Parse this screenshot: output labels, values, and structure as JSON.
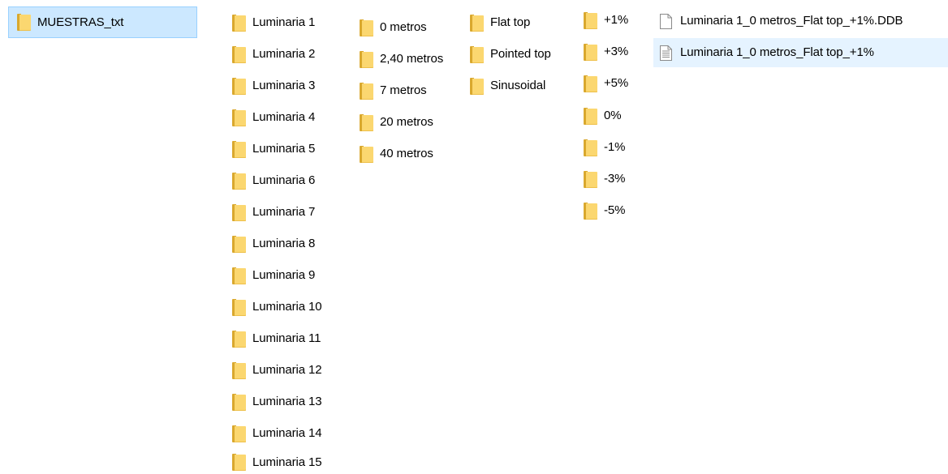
{
  "nav": {
    "root_folder": "MUESTRAS_txt"
  },
  "luminarias": [
    "Luminaria 1",
    "Luminaria 2",
    "Luminaria 3",
    "Luminaria 4",
    "Luminaria 5",
    "Luminaria 6",
    "Luminaria 7",
    "Luminaria 8",
    "Luminaria 9",
    "Luminaria 10",
    "Luminaria 11",
    "Luminaria 12",
    "Luminaria 13",
    "Luminaria 14",
    "Luminaria 15"
  ],
  "distancias": [
    "0 metros",
    "2,40 metros",
    "7 metros",
    "20 metros",
    "40 metros"
  ],
  "perfiles": [
    "Flat top",
    "Pointed top",
    "Sinusoidal"
  ],
  "porcentajes": [
    "+1%",
    "+3%",
    "+5%",
    "0%",
    "-1%",
    "-3%",
    "-5%"
  ],
  "archivos": [
    {
      "name": "Luminaria 1_0 metros_Flat top_+1%.DDB",
      "icon": "blank-file-icon"
    },
    {
      "name": "Luminaria 1_0 metros_Flat top_+1%",
      "icon": "text-file-icon"
    }
  ]
}
